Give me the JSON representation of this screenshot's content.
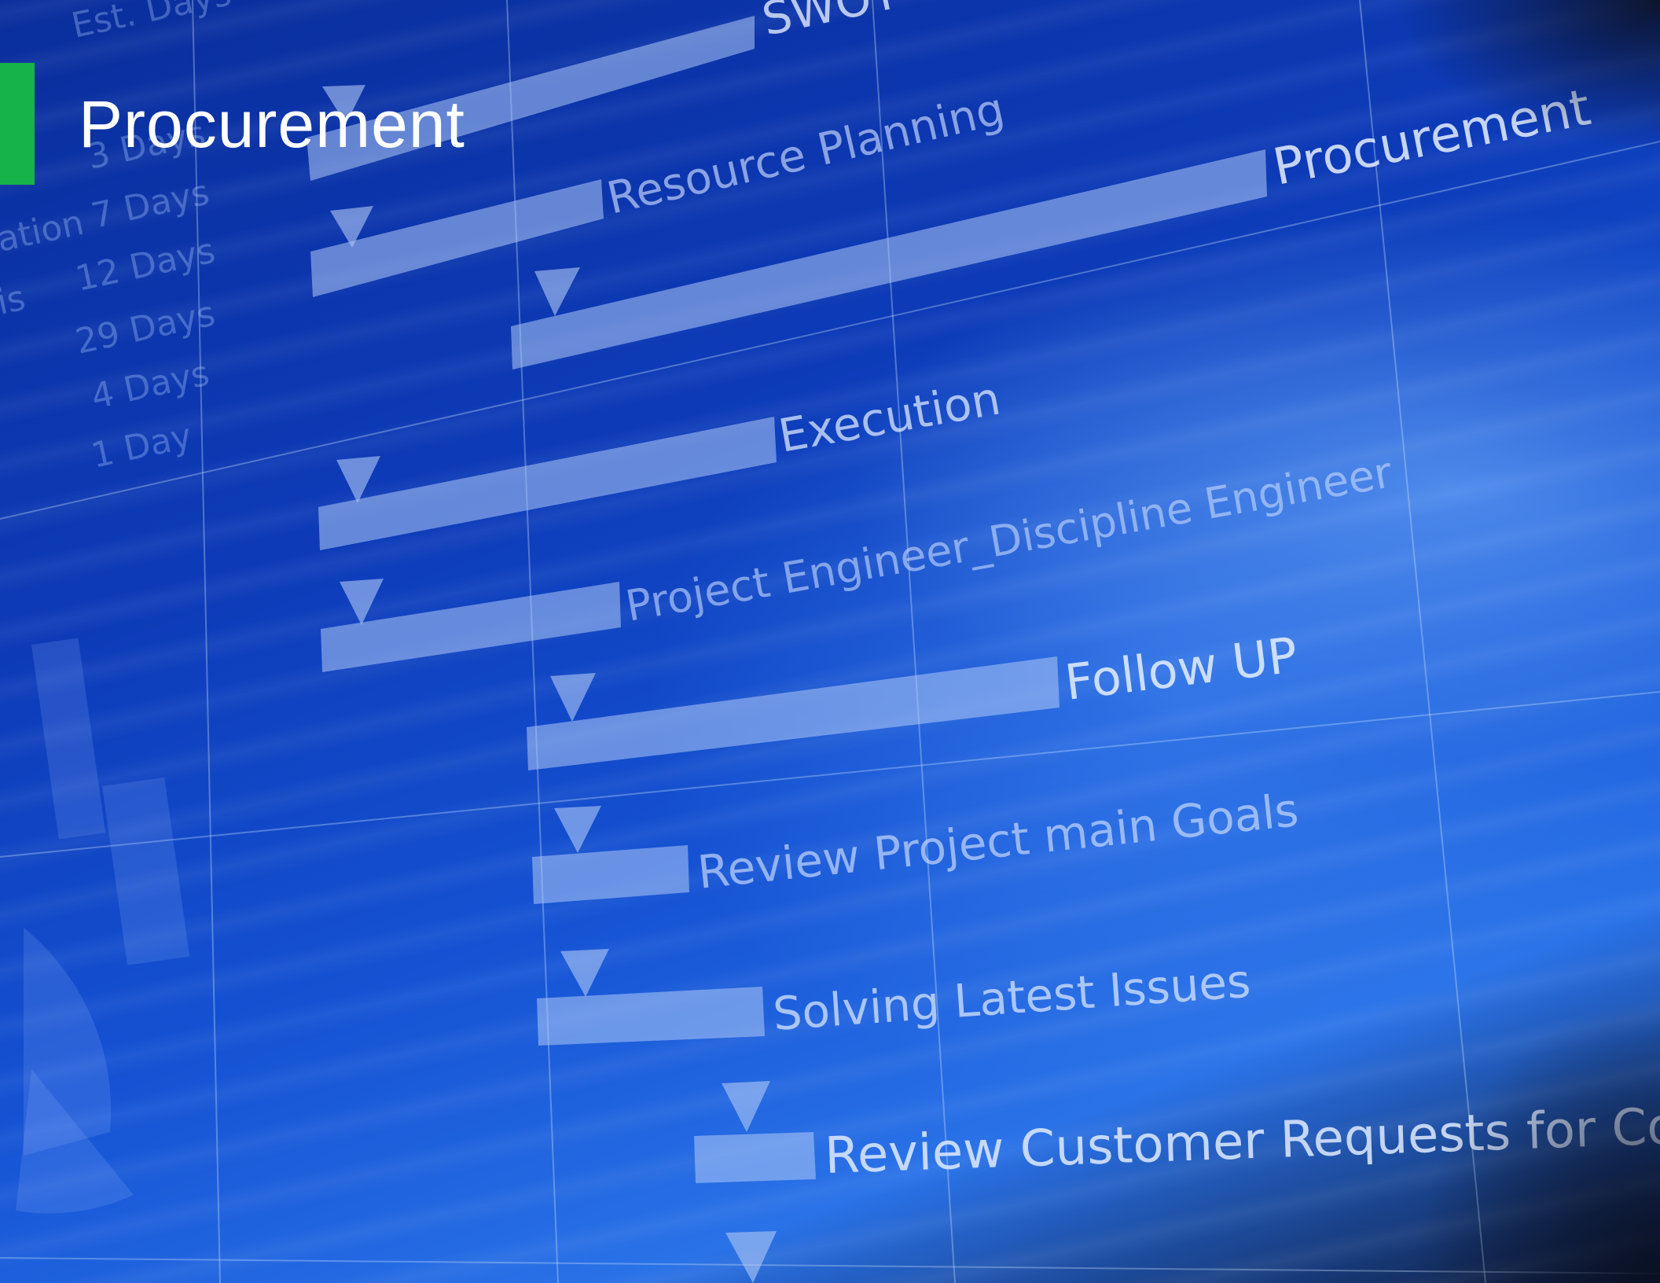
{
  "header": {
    "title": "Procurement",
    "accent_color": "#16b34a"
  },
  "gantt": {
    "column_header": "Est. Days",
    "side_labels": [
      "ation",
      "is"
    ],
    "durations": [
      "3 Days",
      "7 Days",
      "12 Days",
      "29 Days",
      "4 Days",
      "1 Day"
    ],
    "tasks": [
      "SWOT",
      "Resource Planning",
      "Procurement",
      "Execution",
      "Project Engineer_Discipline Engineer",
      "Follow UP",
      "Review Project main Goals",
      "Solving Latest Issues",
      "Review Customer Requests for Com"
    ]
  }
}
